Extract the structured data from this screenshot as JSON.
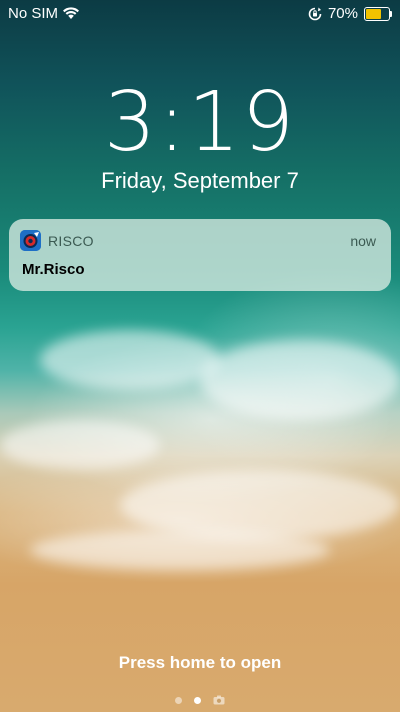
{
  "status_bar": {
    "carrier": "No SIM",
    "battery_percent": "70%",
    "battery_level": 0.7,
    "battery_color": "#f2c300",
    "icons": [
      "wifi-icon",
      "rotation-lock-icon",
      "battery-icon"
    ]
  },
  "lock_screen": {
    "time": "3:19",
    "date": "Friday, September 7"
  },
  "notification": {
    "app_name": "RISCO",
    "time": "now",
    "title": "Mr.Risco",
    "icon": "risco-app-icon"
  },
  "footer": {
    "hint": "Press home to open",
    "page_indicators": [
      "page-dot",
      "page-dot-active",
      "camera-icon"
    ]
  }
}
